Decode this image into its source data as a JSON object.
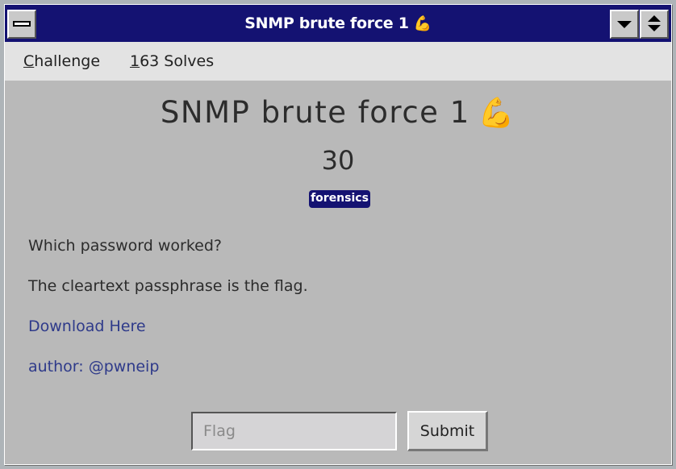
{
  "window": {
    "title": "SNMP brute force 1",
    "title_emoji": "💪"
  },
  "menu": {
    "items": [
      {
        "label": "Challenge",
        "accel": "C",
        "rest": "hallenge"
      },
      {
        "label": "163 Solves",
        "accel": "1",
        "rest": "63 Solves"
      }
    ]
  },
  "challenge": {
    "name": "SNMP brute force 1",
    "emoji": "💪",
    "value": "30",
    "tag": "forensics",
    "description": [
      "Which password worked?",
      "The cleartext passphrase is the flag."
    ],
    "download_link": "Download Here",
    "author": "author: @pwneip"
  },
  "form": {
    "flag_placeholder": "Flag",
    "flag_value": "",
    "submit_label": "Submit"
  },
  "colors": {
    "titlebar": "#141272",
    "tag": "#141272",
    "link": "#2e3a8a"
  },
  "icons": {
    "system_menu": "system-menu-icon",
    "minimize": "minimize-triangle-icon",
    "restore": "restore-arrows-icon",
    "emoji": "flexed-biceps-icon"
  }
}
